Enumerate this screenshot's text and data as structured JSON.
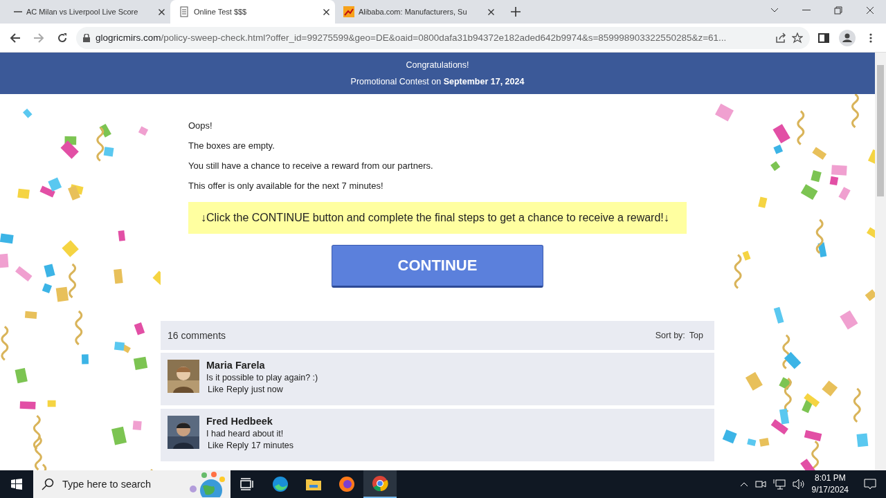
{
  "browser": {
    "tabs": [
      {
        "title": "AC Milan vs Liverpool Live Score",
        "selected": false
      },
      {
        "title": "Online Test $$$",
        "selected": true
      },
      {
        "title": "Alibaba.com: Manufacturers, Su",
        "selected": false
      }
    ],
    "url_host": "glogricmirs.com",
    "url_path": "/policy-sweep-check.html?offer_id=99275599&geo=DE&oaid=0800dafa31b94372e182aded642b9974&s=859998903322550285&z=61..."
  },
  "header": {
    "title": "Congratulations!",
    "subtitle": "Promotional Contest on **September 17, 2024**"
  },
  "message": [
    "Oops!",
    "The boxes are empty.",
    "You still have a chance to receive a reward from our partners.",
    "This offer is only available for the next 7 minutes!"
  ],
  "notice": {
    "arrow_left": "↓",
    "text": "Click the CONTINUE button and complete the final steps to get a chance to receive a reward!",
    "arrow_right": "↓"
  },
  "continue_button": "CONTINUE",
  "comments": {
    "count": "16 comments",
    "sort_label": "Sort by:",
    "sort_value": "Top",
    "items": [
      {
        "name": "Maria Farela",
        "text": "Is it possible to play again? :)",
        "like": "Like",
        "reply": "Reply",
        "time": "just now"
      },
      {
        "name": "Fred Hedbeek",
        "text": "I had heard about it!",
        "like": "Like",
        "reply": "Reply",
        "time": "17 minutes"
      }
    ]
  },
  "taskbar": {
    "search_placeholder": "Type here to search",
    "time": "8:01 PM",
    "date": "9/17/2024"
  }
}
